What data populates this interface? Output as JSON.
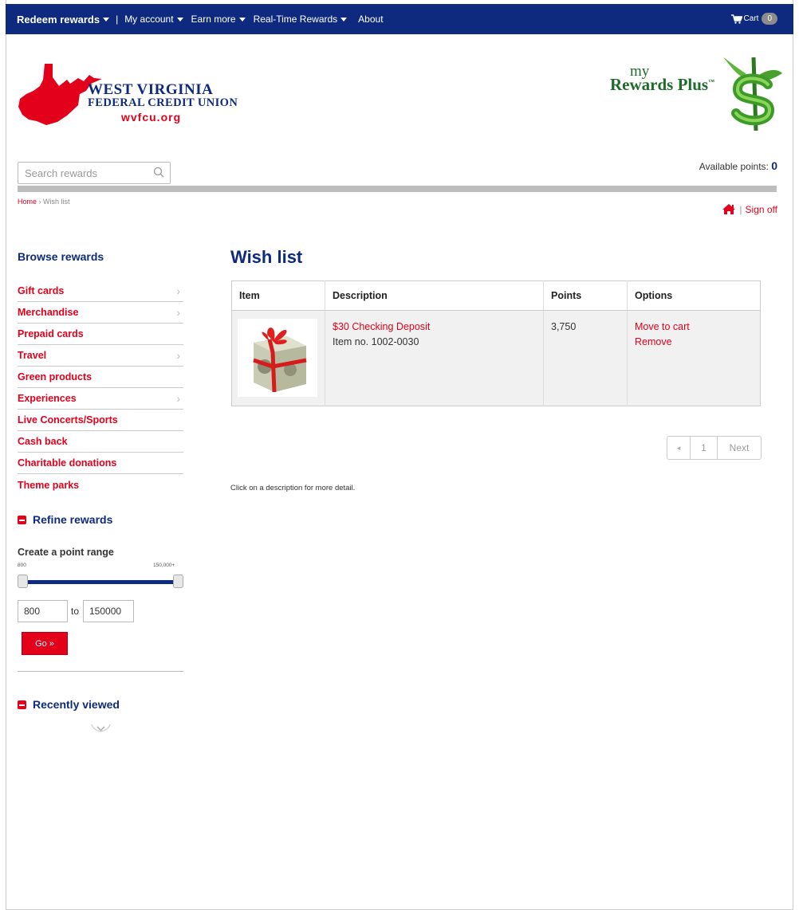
{
  "topnav": {
    "items": [
      {
        "label": "Redeem rewards",
        "dropdown": true
      },
      {
        "label": "My account",
        "dropdown": true
      },
      {
        "label": "Earn more",
        "dropdown": true
      },
      {
        "label": "Real-Time Rewards",
        "dropdown": true
      },
      {
        "label": "About",
        "dropdown": false
      }
    ],
    "separator": "|",
    "cart_label": "Cart",
    "cart_count": "0",
    "bg_color": "#0e2a7e"
  },
  "brand": {
    "org_line1": "West Virginia",
    "org_line2": "Federal Credit Union",
    "url": "wvfcu.org",
    "program_prefix": "my",
    "program_name": "Rewards Plus",
    "program_tm": "™"
  },
  "search": {
    "placeholder": "Search rewards",
    "icon": "search-icon"
  },
  "points": {
    "label": "Available points:",
    "value": "0"
  },
  "breadcrumb": {
    "home": "Home",
    "separator": "›",
    "current": "Wish list"
  },
  "session": {
    "home_icon": "home-icon",
    "separator": "|",
    "signoff_label": "Sign off"
  },
  "sidebar": {
    "browse_title": "Browse rewards",
    "categories": [
      {
        "label": "Gift cards",
        "has_sub": true
      },
      {
        "label": "Merchandise",
        "has_sub": true
      },
      {
        "label": "Prepaid cards",
        "has_sub": false
      },
      {
        "label": "Travel",
        "has_sub": true
      },
      {
        "label": "Green products",
        "has_sub": false
      },
      {
        "label": "Experiences",
        "has_sub": true
      },
      {
        "label": "Live Concerts/Sports",
        "has_sub": false
      },
      {
        "label": "Cash back",
        "has_sub": false
      },
      {
        "label": "Charitable donations",
        "has_sub": false
      },
      {
        "label": "Theme parks",
        "has_sub": false
      }
    ],
    "refine_title": "Refine rewards",
    "range_label": "Create a point range",
    "range_min_label": "800",
    "range_max_label": "150,000+",
    "range_low_fraction": 0,
    "range_high_fraction": 1,
    "range_from": "800",
    "range_to_label": "to",
    "range_to": "150000",
    "go_label": "Go »",
    "recent_title": "Recently viewed",
    "accent_color": "#e3001b"
  },
  "main": {
    "title": "Wish list",
    "columns": [
      "Item",
      "Description",
      "Points",
      "Options"
    ],
    "rows": [
      {
        "image": "gift-wrapped-cash-image",
        "name": "$30 Checking Deposit",
        "item_no": "Item no. 1002-0030",
        "points": "3,750",
        "option1": "Move to cart",
        "option2": "Remove"
      }
    ],
    "pager": {
      "prev_icon": "chevron-left-icon",
      "page": "1",
      "next_label": "Next"
    },
    "note": "Click on a description for more detail."
  }
}
